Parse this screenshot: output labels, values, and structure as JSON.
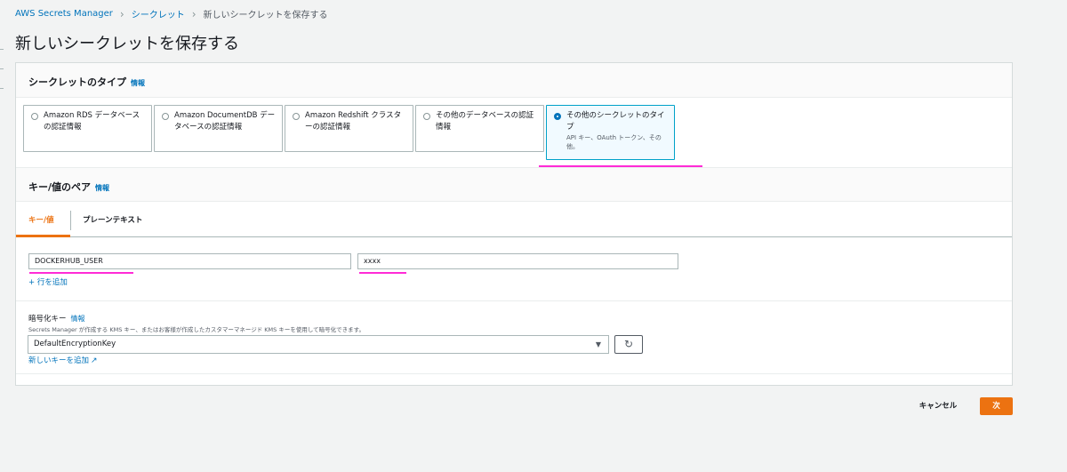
{
  "breadcrumb": {
    "items": [
      "AWS Secrets Manager",
      "シークレット",
      "新しいシークレットを保存する"
    ]
  },
  "page_title": "新しいシークレットを保存する",
  "secret_type": {
    "title": "シークレットのタイプ",
    "info": "情報",
    "options": [
      {
        "label": "Amazon RDS データベースの認証情報",
        "selected": false
      },
      {
        "label": "Amazon DocumentDB データベースの認証情報",
        "selected": false
      },
      {
        "label": "Amazon Redshift クラスターの認証情報",
        "selected": false
      },
      {
        "label": "その他のデータベースの認証情報",
        "selected": false
      },
      {
        "label": "その他のシークレットのタイプ",
        "description": "API キー、OAuth トークン、その他。",
        "selected": true
      }
    ]
  },
  "kv": {
    "title": "キー/値のペア",
    "info": "情報",
    "tabs": [
      {
        "label": "キー/値",
        "active": true
      },
      {
        "label": "プレーンテキスト",
        "active": false
      }
    ],
    "key_value": "DOCKERHUB_USER",
    "value_value": "xxxx",
    "add_row": "+ 行を追加"
  },
  "encryption": {
    "label": "暗号化キー",
    "info": "情報",
    "description": "Secrets Manager が作成する KMS キー、またはお客様が作成したカスタマーマネージド KMS キーを使用して暗号化できます。",
    "selected": "DefaultEncryptionKey",
    "refresh_icon": "refresh-icon",
    "new_key_link": "新しいキーを追加",
    "external_icon": "external-link-icon"
  },
  "footer": {
    "cancel": "キャンセル",
    "next": "次"
  },
  "colors": {
    "accent": "#ec7211",
    "link": "#0073bb",
    "annotation": "#ff2bd6"
  }
}
